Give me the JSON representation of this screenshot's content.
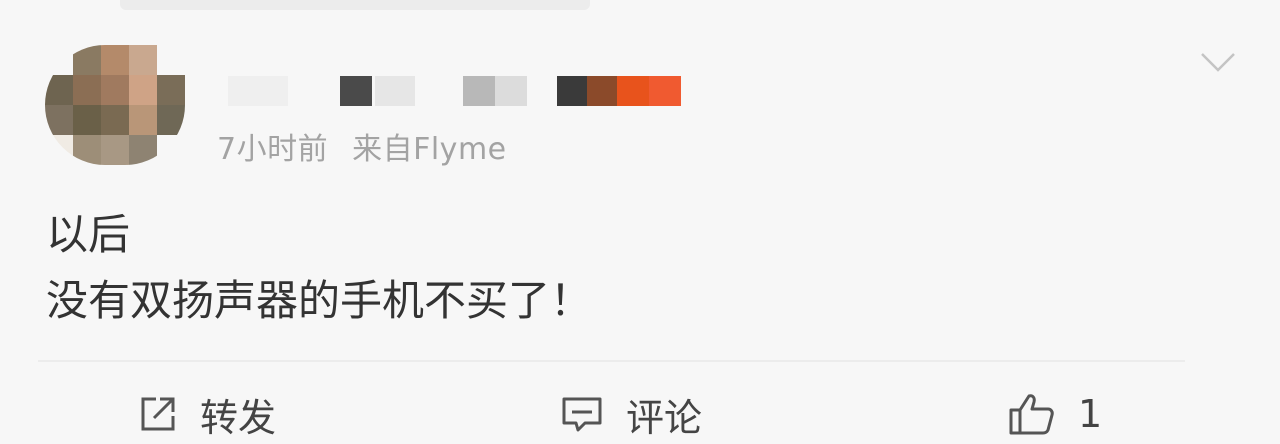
{
  "post": {
    "time": "7小时前",
    "source": "来自Flyme",
    "content_lines": [
      "以后",
      "没有双扬声器的手机不买了！"
    ]
  },
  "actions": {
    "repost_label": "转发",
    "comment_label": "评论",
    "like_count": "1"
  },
  "icons": {
    "repost": "share-box-icon",
    "comment": "comment-bubble-icon",
    "like": "thumbs-up-icon",
    "menu": "chevron-down-icon"
  },
  "colors": {
    "background": "#f7f7f7",
    "meta_text": "#a3a3a3",
    "body_text": "#333333",
    "accent_orange": "#e8531c"
  }
}
